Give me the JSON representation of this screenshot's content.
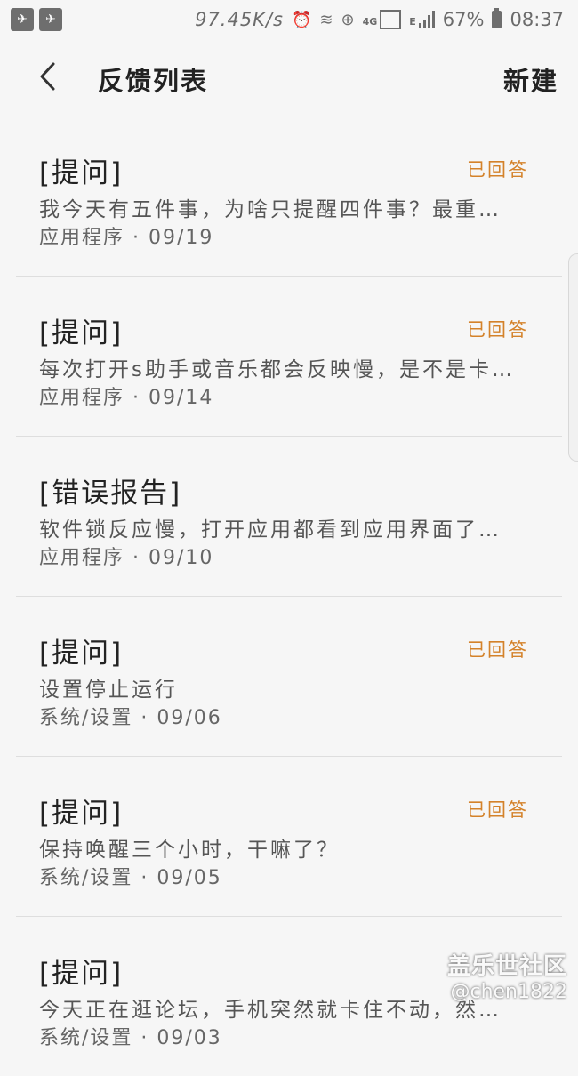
{
  "status_bar": {
    "net_speed": "97.45K/s",
    "net_type_1": "4G",
    "net_type_2": "E",
    "battery": "67%",
    "time": "08:37"
  },
  "header": {
    "title": "反馈列表",
    "new_label": "新建"
  },
  "feedback_items": [
    {
      "type": "[提问]",
      "status": "已回答",
      "text": "我今天有五件事，为啥只提醒四件事？最重…",
      "meta": "应用程序 · 09/19"
    },
    {
      "type": "[提问]",
      "status": "已回答",
      "text": "每次打开s助手或音乐都会反映慢，是不是卡…",
      "meta": "应用程序 · 09/14"
    },
    {
      "type": "[错误报告]",
      "status": "",
      "text": "软件锁反应慢，打开应用都看到应用界面了…",
      "meta": "应用程序 · 09/10"
    },
    {
      "type": "[提问]",
      "status": "已回答",
      "text": "设置停止运行",
      "meta": "系统/设置 · 09/06"
    },
    {
      "type": "[提问]",
      "status": "已回答",
      "text": "保持唤醒三个小时，干嘛了？",
      "meta": "系统/设置 · 09/05"
    },
    {
      "type": "[提问]",
      "status": "",
      "text": "今天正在逛论坛，手机突然就卡住不动，然…",
      "meta": "系统/设置 · 09/03"
    }
  ],
  "watermark": {
    "site": "盖乐世社区",
    "user": "@chen1822"
  },
  "colors": {
    "accent_status": "#d4822a",
    "background": "#f6f6f6"
  }
}
